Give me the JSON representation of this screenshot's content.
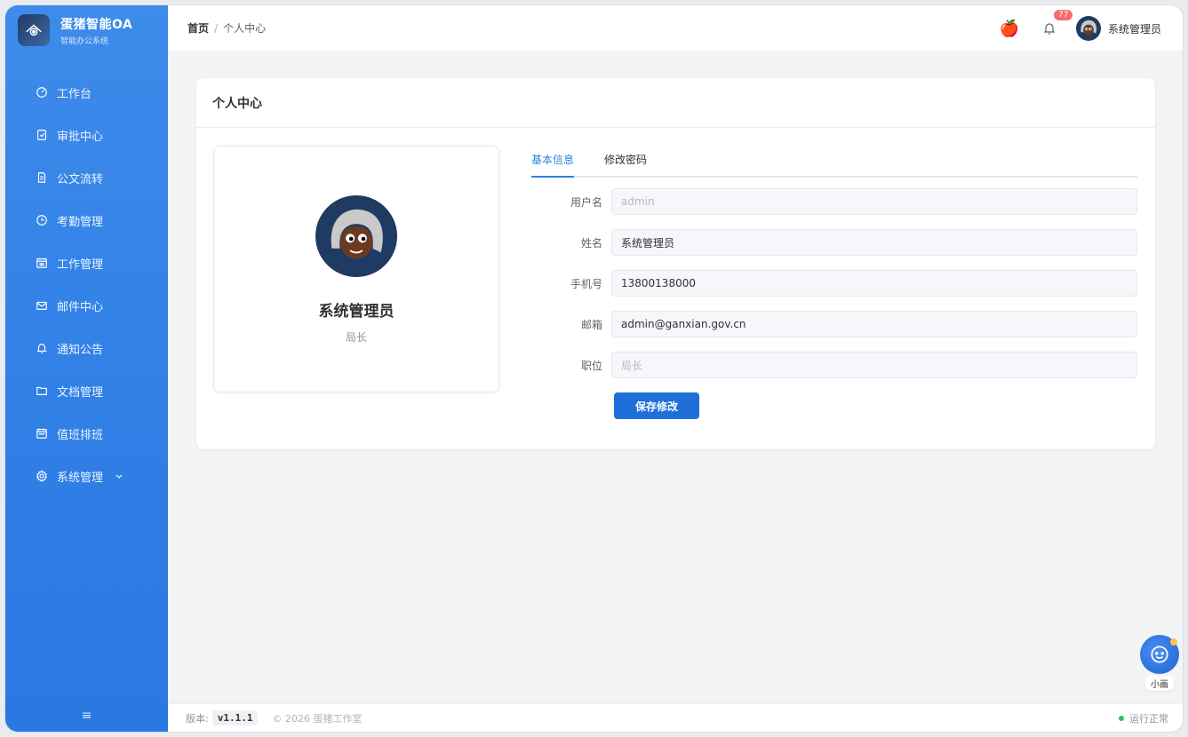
{
  "brand": {
    "title": "蛋猪智能OA",
    "subtitle": "智能办公系统"
  },
  "sidebar": {
    "items": [
      {
        "label": "工作台",
        "icon": "dashboard-icon"
      },
      {
        "label": "审批中心",
        "icon": "approval-icon"
      },
      {
        "label": "公文流转",
        "icon": "document-icon"
      },
      {
        "label": "考勤管理",
        "icon": "clock-icon"
      },
      {
        "label": "工作管理",
        "icon": "calendar-icon"
      },
      {
        "label": "邮件中心",
        "icon": "mail-icon"
      },
      {
        "label": "通知公告",
        "icon": "bell-icon"
      },
      {
        "label": "文档管理",
        "icon": "folder-icon"
      },
      {
        "label": "值班排班",
        "icon": "schedule-icon"
      },
      {
        "label": "系统管理",
        "icon": "gear-icon"
      }
    ],
    "collapse_glyph": "≡"
  },
  "header": {
    "breadcrumb_home": "首页",
    "breadcrumb_sep": "/",
    "breadcrumb_current": "个人中心",
    "apple_glyph": "🍎",
    "notification_count": "77",
    "user_name": "系统管理员"
  },
  "card": {
    "title": "个人中心"
  },
  "profile": {
    "name": "系统管理员",
    "position": "局长"
  },
  "tabs": [
    {
      "label": "基本信息"
    },
    {
      "label": "修改密码"
    }
  ],
  "form": {
    "username": {
      "label": "用户名",
      "value": "admin"
    },
    "realname": {
      "label": "姓名",
      "value": "系统管理员"
    },
    "phone": {
      "label": "手机号",
      "value": "13800138000"
    },
    "email": {
      "label": "邮箱",
      "value": "admin@ganxian.gov.cn"
    },
    "position": {
      "label": "职位",
      "value": "局长"
    },
    "save_label": "保存修改"
  },
  "footer": {
    "version_label": "版本:",
    "version": "v1.1.1",
    "copyright": "© 2026 蛋猪工作室",
    "status": "运行正常"
  },
  "assistant": {
    "label": "小画"
  },
  "colors": {
    "primary": "#2f7fe6",
    "badge": "#f56c6c",
    "status_ok": "#22c55e"
  }
}
